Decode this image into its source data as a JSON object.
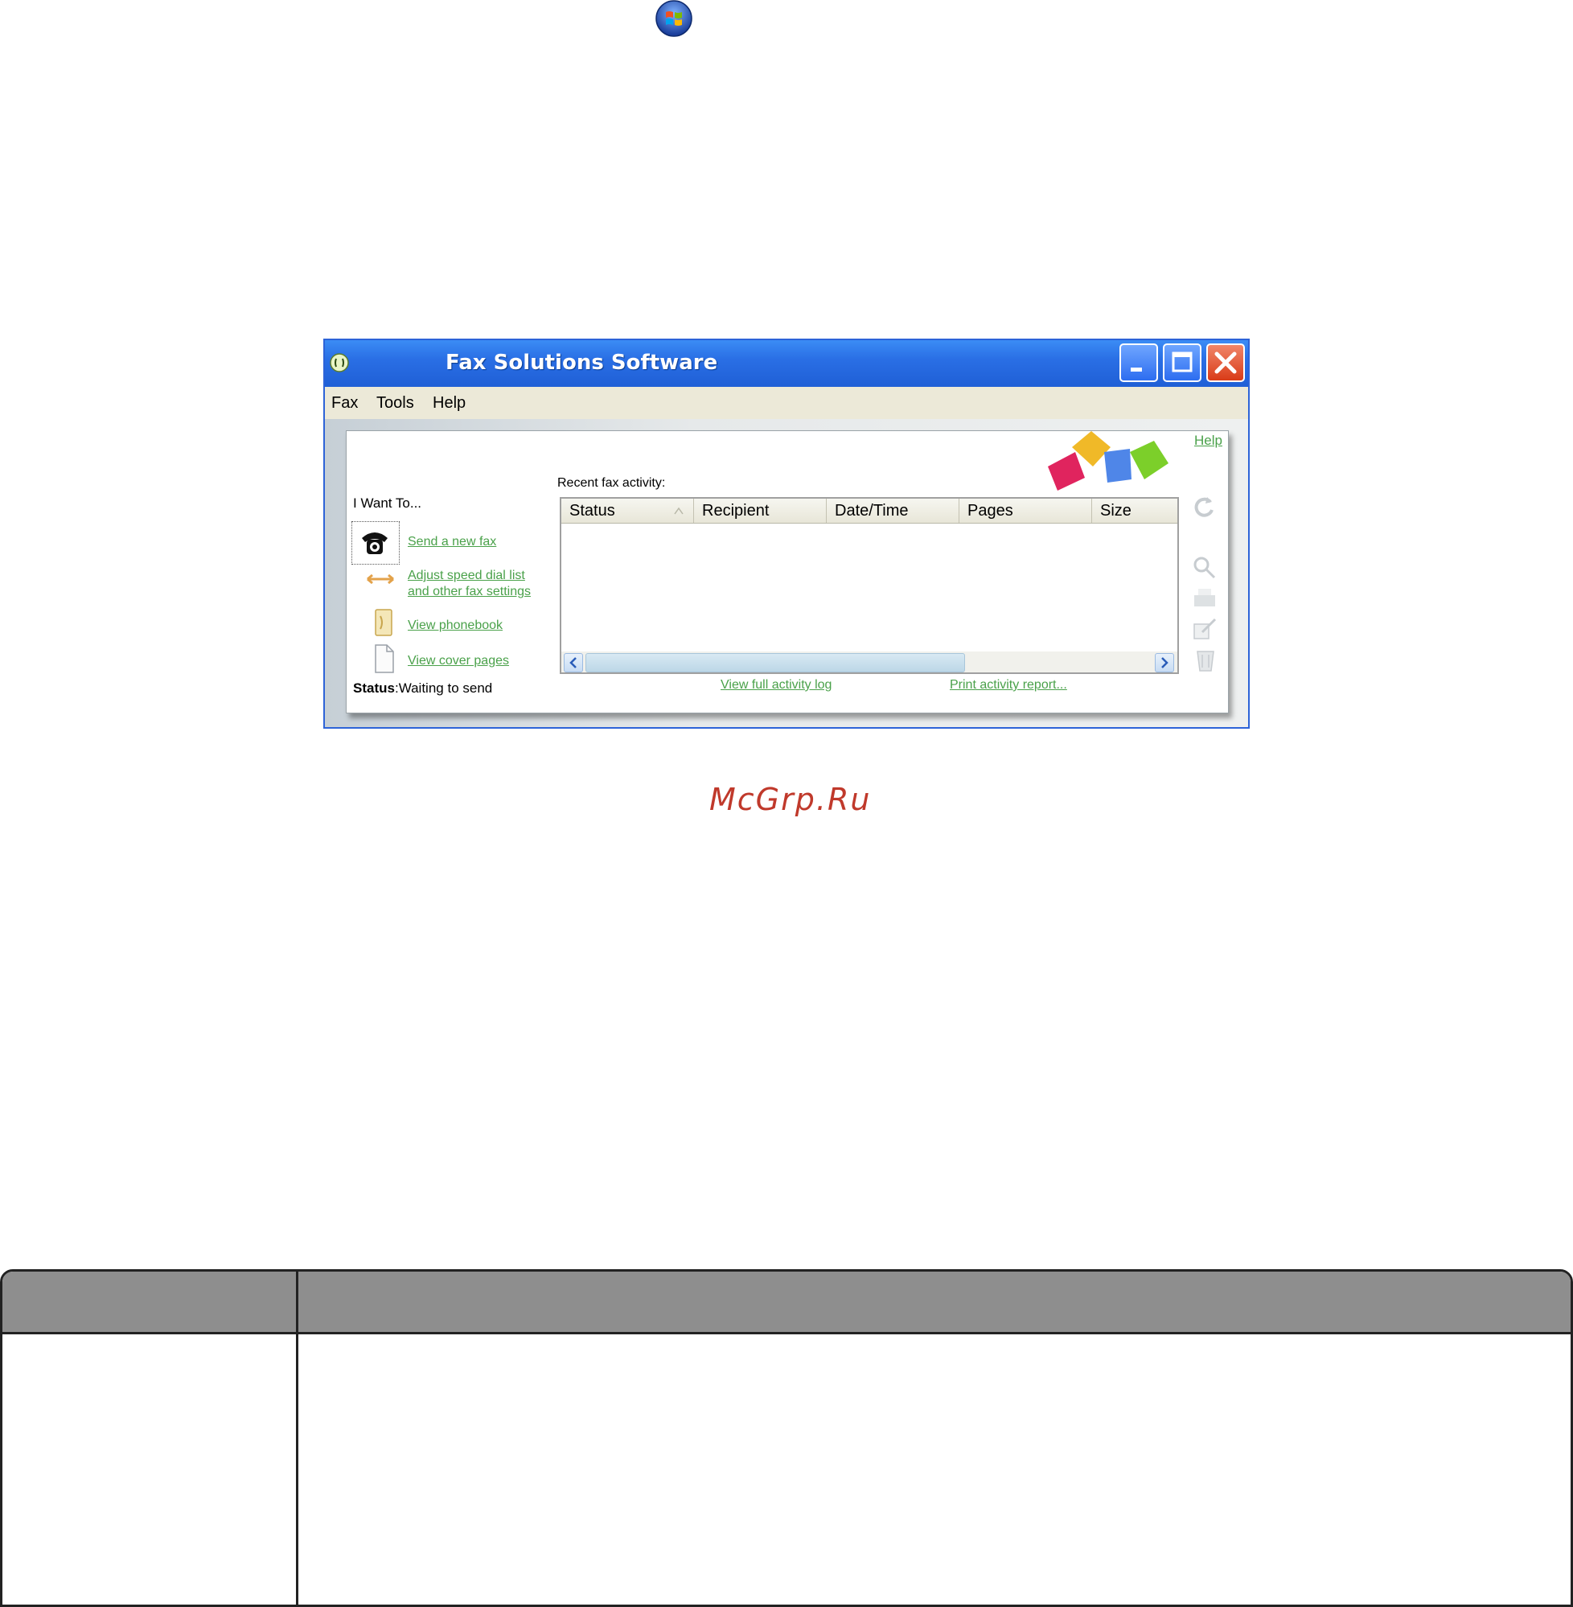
{
  "window": {
    "title": "Fax Solutions Software",
    "menu": [
      "Fax",
      "Tools",
      "Help"
    ]
  },
  "panel": {
    "help_link": "Help",
    "i_want_to": "I Want To...",
    "actions": [
      {
        "icon": "telephone-icon",
        "label": "Send a new fax"
      },
      {
        "icon": "arrows-icon",
        "label_line1": "Adjust speed dial list",
        "label_line2": "and other fax settings"
      },
      {
        "icon": "phonebook-icon",
        "label": "View phonebook"
      },
      {
        "icon": "page-icon",
        "label": "View cover pages"
      }
    ],
    "status_label": "Status",
    "status_value": ":Waiting to send",
    "recent_label": "Recent fax activity:",
    "columns": [
      "Status",
      "Recipient",
      "Date/Time",
      "Pages",
      "Size"
    ],
    "rows": [],
    "view_log_link": "View full activity log",
    "print_report_link": "Print activity report..."
  },
  "watermark": "McGrp.Ru",
  "colors": {
    "title_bar": "#2a6fe5",
    "link_green": "#4aa14a",
    "watermark_red": "#c0392b",
    "table_header_gray": "#8e8e8e"
  }
}
